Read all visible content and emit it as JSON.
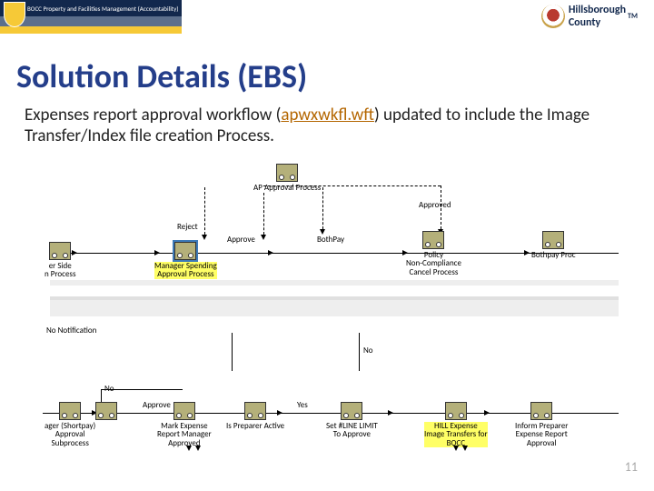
{
  "header": {
    "org_text": "BOCC Property and Facilities Management (Accountability)",
    "right_name": "Hillsborough",
    "right_sub": "County"
  },
  "tm": "TM",
  "title": "Solution Details (EBS)",
  "subtitle_pre": "Expenses report approval workflow (",
  "wft_file": "apwxwkfl.wft",
  "subtitle_post": ") updated to include the Image Transfer/Index file creation Process.",
  "top": {
    "ap_approval": "AP Approval Process",
    "reject": "Reject",
    "approve": "Approve",
    "approved": "Approved",
    "server_side": "er Side\nn Process",
    "mgr_spending": "Manager Spending\nApproval Process",
    "bothpay": "BothPay",
    "policy": "Policy\nNon-Compliance\nCancel Process",
    "bothpay_proc": "Bothpay Proc"
  },
  "mid": "No Notification",
  "bot": {
    "no_small": "No",
    "no_big": "No",
    "approve": "Approve",
    "yes": "Yes",
    "ager_shortpay": "ager (Shortpay)\nApproval\nSubprocess",
    "mark_expense": "Mark Expense\nReport Manager\nApproved",
    "is_preparer": "Is Preparer Active",
    "set_limit": "Set #LINE LIMIT\nTo Approve",
    "hill_expense": "HILL Expense\nImage Transfers for\nBOCC",
    "inform_preparer": "Inform Preparer\nExpense Report\nApproval"
  },
  "page_number": "11"
}
